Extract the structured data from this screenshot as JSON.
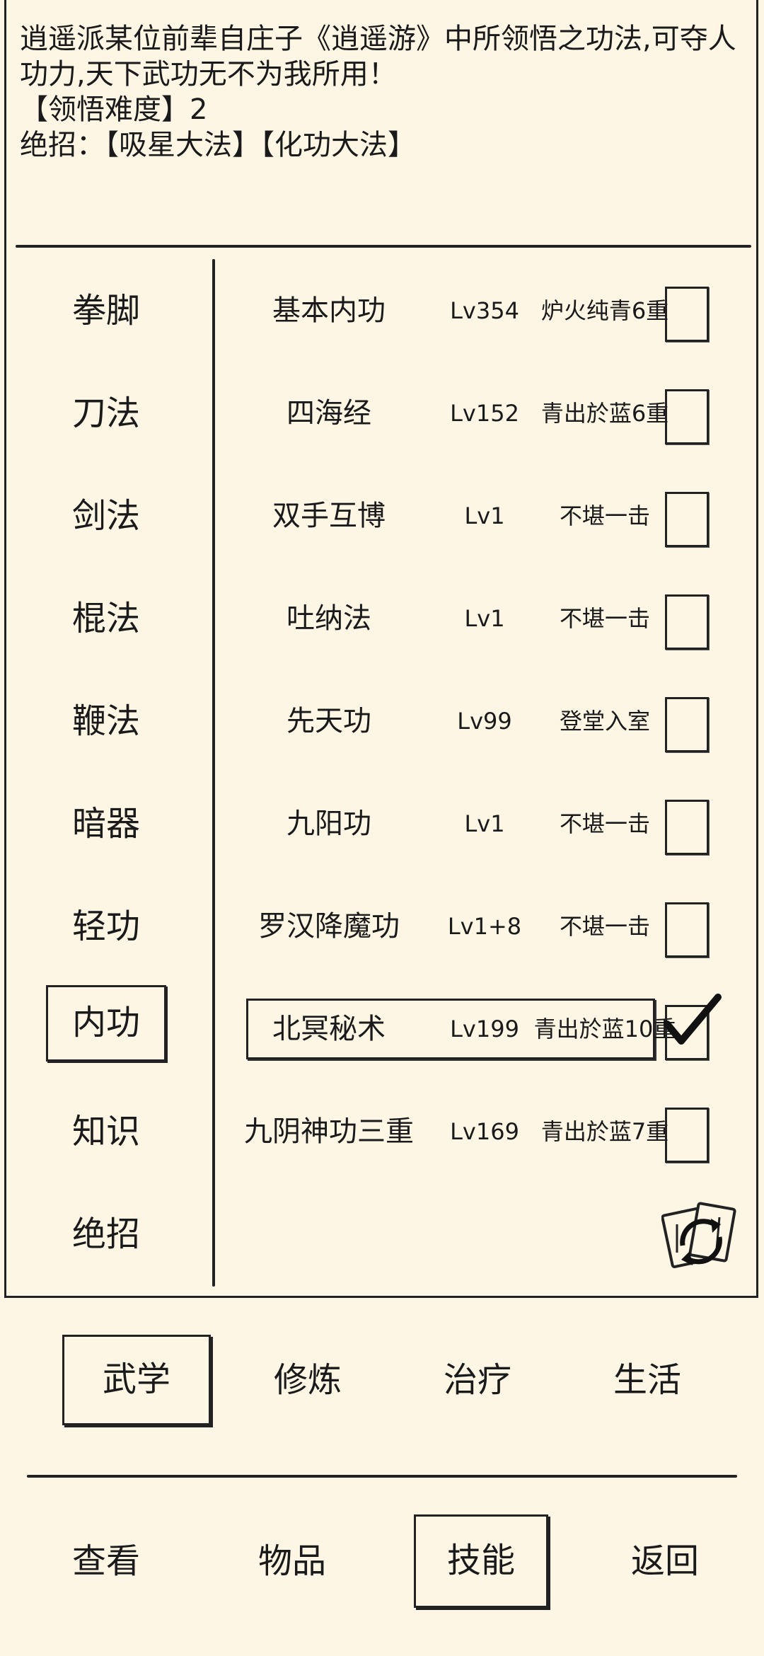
{
  "description": {
    "text": "逍遥派某位前辈自庄子《逍遥游》中所领悟之功法,可夺人功力,天下武功无不为我所用！",
    "difficulty": "【领悟难度】2",
    "ultimate": "绝招：【吸星大法】【化功大法】"
  },
  "categories": [
    {
      "label": "拳脚"
    },
    {
      "label": "刀法"
    },
    {
      "label": "剑法"
    },
    {
      "label": "棍法"
    },
    {
      "label": "鞭法"
    },
    {
      "label": "暗器"
    },
    {
      "label": "轻功"
    },
    {
      "label": "内功",
      "active": true
    },
    {
      "label": "知识"
    },
    {
      "label": "绝招"
    }
  ],
  "skills": [
    {
      "name": "基本内功",
      "level": "Lv354",
      "status": "炉火纯青6重",
      "checked": false
    },
    {
      "name": "四海经",
      "level": "Lv152",
      "status": "青出於蓝6重",
      "checked": false
    },
    {
      "name": "双手互博",
      "level": "Lv1",
      "status": "不堪一击",
      "checked": false
    },
    {
      "name": "吐纳法",
      "level": "Lv1",
      "status": "不堪一击",
      "checked": false
    },
    {
      "name": "先天功",
      "level": "Lv99",
      "status": "登堂入室",
      "checked": false
    },
    {
      "name": "九阳功",
      "level": "Lv1",
      "status": "不堪一击",
      "checked": false
    },
    {
      "name": "罗汉降魔功",
      "level": "Lv1+8",
      "status": "不堪一击",
      "checked": false
    },
    {
      "name": "北冥秘术",
      "level": "Lv199",
      "status": "青出於蓝10重",
      "checked": true,
      "active": true
    },
    {
      "name": "九阴神功三重",
      "level": "Lv169",
      "status": "青出於蓝7重",
      "checked": false
    }
  ],
  "tabs": [
    {
      "label": "武学",
      "active": true
    },
    {
      "label": "修炼"
    },
    {
      "label": "治疗"
    },
    {
      "label": "生活"
    }
  ],
  "nav": [
    {
      "label": "查看"
    },
    {
      "label": "物品"
    },
    {
      "label": "技能",
      "active": true
    },
    {
      "label": "返回"
    }
  ],
  "icons": {
    "refresh": "refresh-cards-icon",
    "check": "checkmark-icon"
  }
}
